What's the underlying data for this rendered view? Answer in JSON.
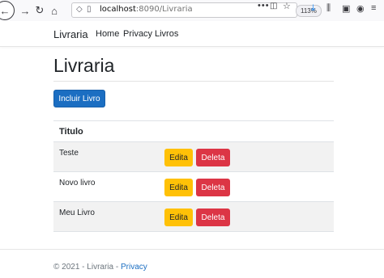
{
  "browser": {
    "url_host": "localhost",
    "url_path": ":8090/Livraria",
    "zoom": "113%",
    "more_dots": "•••"
  },
  "navbar": {
    "brand": "Livraria",
    "links": [
      "Home",
      "Privacy",
      "Livros"
    ]
  },
  "page": {
    "title": "Livraria",
    "add_button": "Incluir Livro"
  },
  "table": {
    "headers": [
      "Titulo"
    ],
    "rows": [
      {
        "title": "Teste",
        "edit": "Edita",
        "delete": "Deleta"
      },
      {
        "title": "Novo livro",
        "edit": "Edita",
        "delete": "Deleta"
      },
      {
        "title": "Meu Livro",
        "edit": "Edita",
        "delete": "Deleta"
      }
    ]
  },
  "footer": {
    "text": "© 2021 - Livraria - ",
    "link": "Privacy"
  },
  "colors": {
    "primary": "#1b6ec2",
    "warning": "#ffc107",
    "danger": "#dc3545"
  }
}
